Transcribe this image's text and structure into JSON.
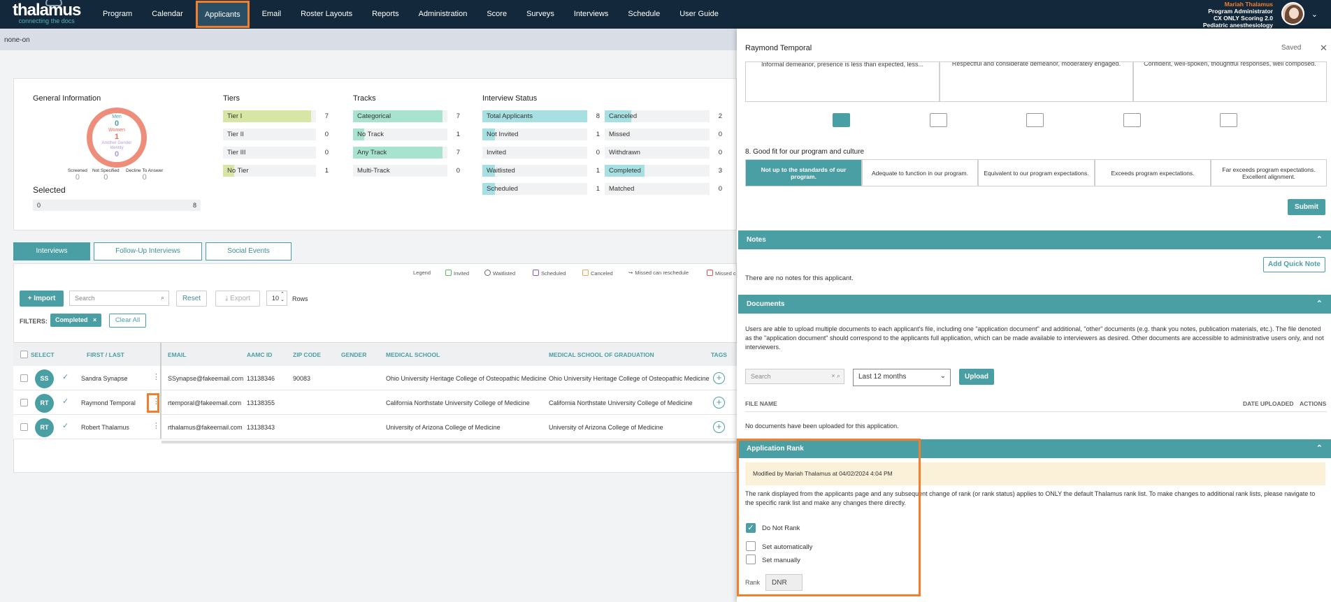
{
  "app": {
    "brand": "thalamus",
    "tagline": "connecting the docs"
  },
  "nav": [
    "Program",
    "Calendar",
    "Applicants",
    "Email",
    "Roster Layouts",
    "Reports",
    "Administration",
    "Score",
    "Surveys",
    "Interviews",
    "Schedule",
    "User Guide"
  ],
  "user": {
    "name": "Mariah Thalamus",
    "role": "Program Administrator",
    "org": "CX ONLY Scoring 2.0",
    "dept": "Pediatric anesthesiology"
  },
  "subbar": "none-on",
  "general": {
    "title": "General Information",
    "men_label": "Men",
    "men": "0",
    "women_label": "Women",
    "women": "1",
    "other_label": "Another Gender Identity",
    "other": "0",
    "screened_label": "Screened",
    "screened": "0",
    "ns_label": "Not Specified",
    "ns": "0",
    "dta_label": "Decline To Answer",
    "dta": "0",
    "selected_title": "Selected",
    "selected_left": "0",
    "selected_right": "8"
  },
  "tiers": {
    "title": "Tiers",
    "rows": [
      {
        "label": "Tier I",
        "count": "7",
        "fill": 0.95
      },
      {
        "label": "Tier II",
        "count": "0",
        "fill": 0
      },
      {
        "label": "Tier III",
        "count": "0",
        "fill": 0
      },
      {
        "label": "No Tier",
        "count": "1",
        "fill": 0.12
      }
    ]
  },
  "tracks": {
    "title": "Tracks",
    "rows": [
      {
        "label": "Categorical",
        "count": "7",
        "fill": 0.95
      },
      {
        "label": "No Track",
        "count": "1",
        "fill": 0.12
      },
      {
        "label": "Any Track",
        "count": "7",
        "fill": 0.95
      },
      {
        "label": "Multi-Track",
        "count": "0",
        "fill": 0
      }
    ]
  },
  "interview_status": {
    "title": "Interview Status",
    "left": [
      {
        "label": "Total Applicants",
        "count": "8",
        "fill": 1
      },
      {
        "label": "Not Invited",
        "count": "1",
        "fill": 0.12
      },
      {
        "label": "Invited",
        "count": "0",
        "fill": 0
      },
      {
        "label": "Waitlisted",
        "count": "1",
        "fill": 0.12
      },
      {
        "label": "Scheduled",
        "count": "1",
        "fill": 0.12
      }
    ],
    "right": [
      {
        "label": "Canceled",
        "count": "2",
        "fill": 0.25
      },
      {
        "label": "Missed",
        "count": "0",
        "fill": 0
      },
      {
        "label": "Withdrawn",
        "count": "0",
        "fill": 0
      },
      {
        "label": "Completed",
        "count": "3",
        "fill": 0.38
      },
      {
        "label": "Matched",
        "count": "0",
        "fill": 0
      }
    ]
  },
  "tabs": [
    "Interviews",
    "Follow-Up Interviews",
    "Social Events"
  ],
  "legend": {
    "title": "Legend",
    "items": [
      "Invited",
      "Waitlisted",
      "Scheduled",
      "Canceled",
      "Missed can reschedule",
      "Missed c"
    ]
  },
  "toolbar": {
    "import": "+ Import",
    "search_placeholder": "Search",
    "reset": "Reset",
    "export": "⤓ Export",
    "rows_value": "10",
    "rows_label": "Rows"
  },
  "filters": {
    "label": "FILTERS:",
    "chip": "Completed",
    "clear": "Clear All"
  },
  "columns": [
    "SELECT",
    "FIRST / LAST",
    "EMAIL",
    "AAMC ID",
    "ZIP CODE",
    "GENDER",
    "MEDICAL SCHOOL",
    "MEDICAL SCHOOL OF GRADUATION",
    "TAGS"
  ],
  "rows": [
    {
      "initials": "SS",
      "name": "Sandra Synapse",
      "email": "SSynapse@fakeemail.com",
      "aamc": "13138346",
      "zip": "90083",
      "gender": "",
      "school": "Ohio University Heritage College of Osteopathic Medicine",
      "grad": "Ohio University Heritage College of Osteopathic Medicine"
    },
    {
      "initials": "RT",
      "name": "Raymond Temporal",
      "email": "rtemporal@fakeemail.com",
      "aamc": "13138355",
      "zip": "",
      "gender": "",
      "school": "California Northstate University College of Medicine",
      "grad": "California Northstate University College of Medicine"
    },
    {
      "initials": "RT",
      "name": "Robert Thalamus",
      "email": "rthalamus@fakeemail.com",
      "aamc": "13138343",
      "zip": "",
      "gender": "",
      "school": "University of Arizona College of Medicine",
      "grad": "University of Arizona College of Medicine"
    }
  ],
  "panel": {
    "title": "Raymond Temporal",
    "saved": "Saved",
    "prev_row": [
      "Informal demeanor, presence is less than expected, less...",
      "Respectful and considerate demeanor, moderately engaged.",
      "Confident, well-spoken, thoughtful responses, well composed."
    ],
    "q8": "8. Good fit for our program and culture",
    "q8_options": [
      "Not up to the standards of our program.",
      "Adequate to function in our program.",
      "Equivalent to our program expectations.",
      "Exceeds program expectations.",
      "Far exceeds program expectations. Excellent alignment."
    ],
    "submit": "Submit",
    "notes_title": "Notes",
    "add_note": "Add Quick Note",
    "notes_empty": "There are no notes for this applicant.",
    "docs_title": "Documents",
    "docs_text": "Users are able to upload multiple documents to each applicant's file, including one \"application document\" and additional, \"other\" documents (e.g. thank you notes, publication materials, etc.). The file denoted as the \"application document\" should correspond to the applicants full application, which can be made available to interviewers as desired. Other documents are accessible to administrative users only, and not interviewers.",
    "docs_search": "Search",
    "docs_period": "Last 12 months",
    "upload": "Upload",
    "col_file": "FILE NAME",
    "col_date": "DATE UPLOADED",
    "col_actions": "ACTIONS",
    "docs_empty": "No documents have been uploaded for this application.",
    "rank_title": "Application Rank",
    "rank_modified": "Modified by Mariah Thalamus at 04/02/2024 4:04 PM",
    "rank_text": "The rank displayed from the applicants page and any subsequent change of rank (or rank status) applies to ONLY the default Thalamus rank list. To make changes to additional rank lists, please navigate to the specific rank list and make any changes there directly.",
    "opt_dnr": "Do Not Rank",
    "opt_auto": "Set automatically",
    "opt_manual": "Set manually",
    "rank_label": "Rank",
    "rank_value": "DNR"
  },
  "colors": {
    "accent": "#4a9fa5",
    "highlight": "#f07f2e",
    "topbar": "#13283b"
  }
}
